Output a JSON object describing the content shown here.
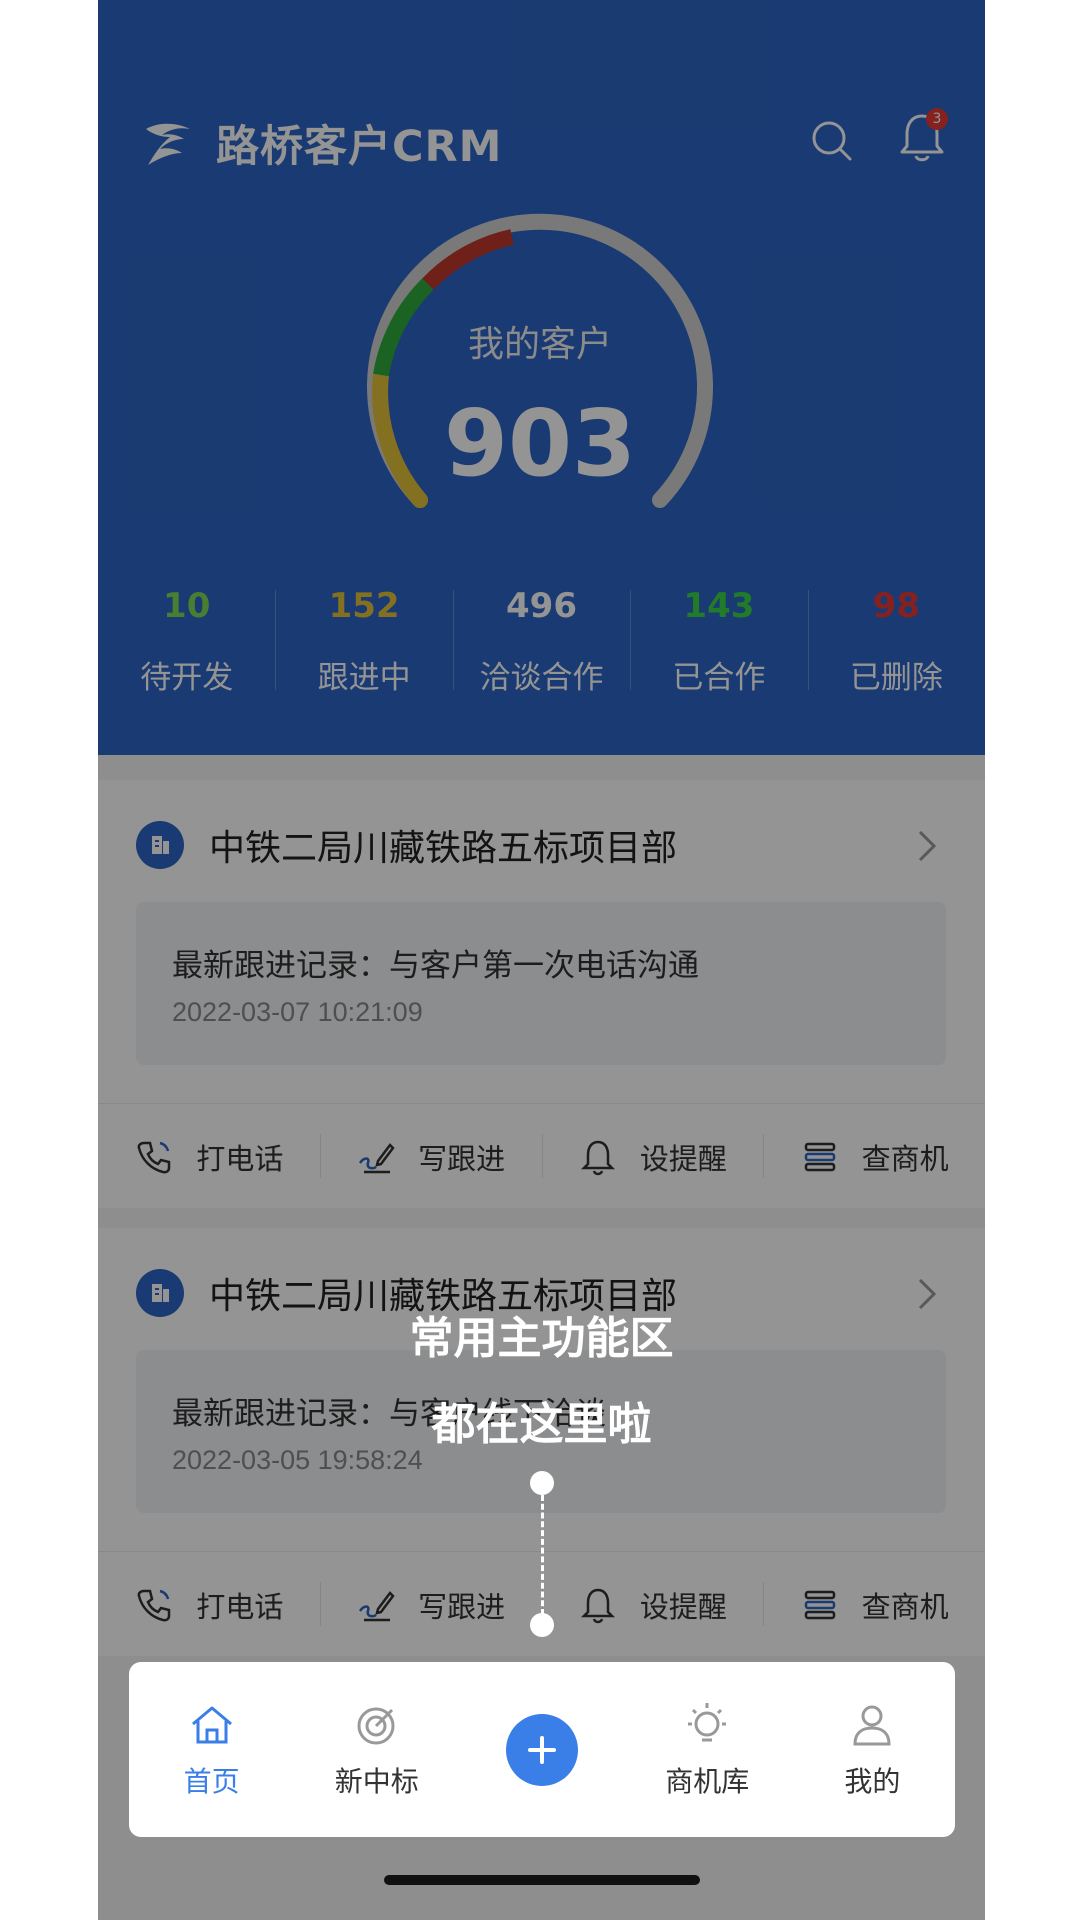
{
  "app": {
    "title": "路桥客户CRM",
    "notification_count": "3"
  },
  "summary": {
    "label": "我的客户",
    "total": "903"
  },
  "stats": [
    {
      "value": "10",
      "label": "待开发",
      "color": "#7ed957"
    },
    {
      "value": "152",
      "label": "跟进中",
      "color": "#e3c23a"
    },
    {
      "value": "496",
      "label": "洽谈合作",
      "color": "#ffffff"
    },
    {
      "value": "143",
      "label": "已合作",
      "color": "#3cd447"
    },
    {
      "value": "98",
      "label": "已删除",
      "color": "#e53935"
    }
  ],
  "cards": [
    {
      "company": "中铁二局川藏铁路五标项目部",
      "record": "最新跟进记录：与客户第一次电话沟通",
      "time": "2022-03-07 10:21:09"
    },
    {
      "company": "中铁二局川藏铁路五标项目部",
      "record": "最新跟进记录：与客户线下洽谈",
      "time": "2022-03-05 19:58:24"
    }
  ],
  "actions": {
    "call": "打电话",
    "write": "写跟进",
    "remind": "设提醒",
    "opportunity": "查商机"
  },
  "guide": {
    "line1": "常用主功能区",
    "line2": "都在这里啦"
  },
  "tabbar": {
    "home": "首页",
    "bid": "新中标",
    "opportunities": "商机库",
    "mine": "我的"
  },
  "colors": {
    "brand": "#2c64c4",
    "accent": "#3a7ee8"
  },
  "icons": [
    "logo-icon",
    "search-icon",
    "bell-icon",
    "building-icon",
    "chevron-right-icon",
    "phone-icon",
    "pen-icon",
    "bell-icon",
    "list-icon",
    "home-icon",
    "target-icon",
    "plus-icon",
    "bulb-icon",
    "user-icon"
  ]
}
